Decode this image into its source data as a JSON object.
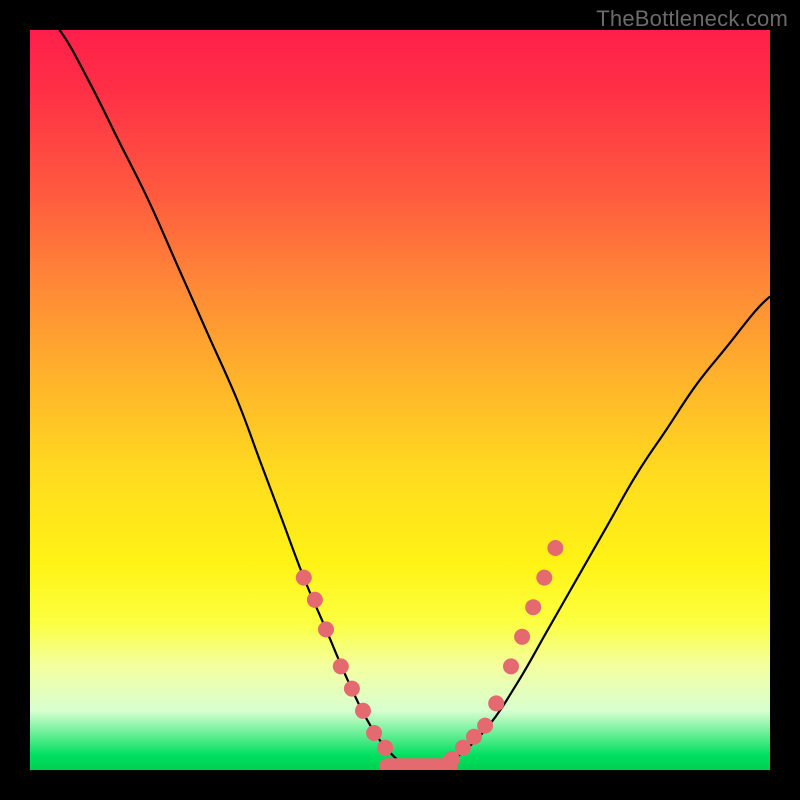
{
  "watermark": "TheBottleneck.com",
  "colors": {
    "frame_bg": "#000000",
    "curve": "#000000",
    "marker": "#e46a6f",
    "gradient_top": "#ff1f4a",
    "gradient_bottom": "#00d050"
  },
  "chart_data": {
    "type": "line",
    "title": "",
    "xlabel": "",
    "ylabel": "",
    "xlim": [
      0,
      100
    ],
    "ylim": [
      0,
      100
    ],
    "grid": false,
    "series": [
      {
        "name": "bottleneck-curve",
        "x": [
          0,
          4,
          8,
          12,
          16,
          20,
          24,
          28,
          31,
          34,
          37,
          40,
          43,
          46,
          49,
          52,
          55,
          58,
          62,
          66,
          70,
          74,
          78,
          82,
          86,
          90,
          94,
          98,
          100
        ],
        "y": [
          104,
          100,
          93,
          85,
          77,
          68,
          59,
          50,
          42,
          34,
          26,
          19,
          12,
          6,
          2,
          0,
          0,
          2,
          6,
          12,
          19,
          26,
          33,
          40,
          46,
          52,
          57,
          62,
          64
        ]
      }
    ],
    "markers": {
      "left_branch": [
        {
          "x": 37,
          "y": 26
        },
        {
          "x": 38.5,
          "y": 23
        },
        {
          "x": 40,
          "y": 19
        },
        {
          "x": 42,
          "y": 14
        },
        {
          "x": 43.5,
          "y": 11
        },
        {
          "x": 45,
          "y": 8
        },
        {
          "x": 46.5,
          "y": 5
        },
        {
          "x": 48,
          "y": 3
        }
      ],
      "right_branch": [
        {
          "x": 57,
          "y": 1.5
        },
        {
          "x": 58.5,
          "y": 3
        },
        {
          "x": 60,
          "y": 4.5
        },
        {
          "x": 61.5,
          "y": 6
        },
        {
          "x": 63,
          "y": 9
        },
        {
          "x": 65,
          "y": 14
        },
        {
          "x": 66.5,
          "y": 18
        },
        {
          "x": 68,
          "y": 22
        },
        {
          "x": 69.5,
          "y": 26
        },
        {
          "x": 71,
          "y": 30
        }
      ],
      "bottom_flat": {
        "x_start": 48,
        "x_end": 57,
        "y": 0.5
      }
    }
  }
}
